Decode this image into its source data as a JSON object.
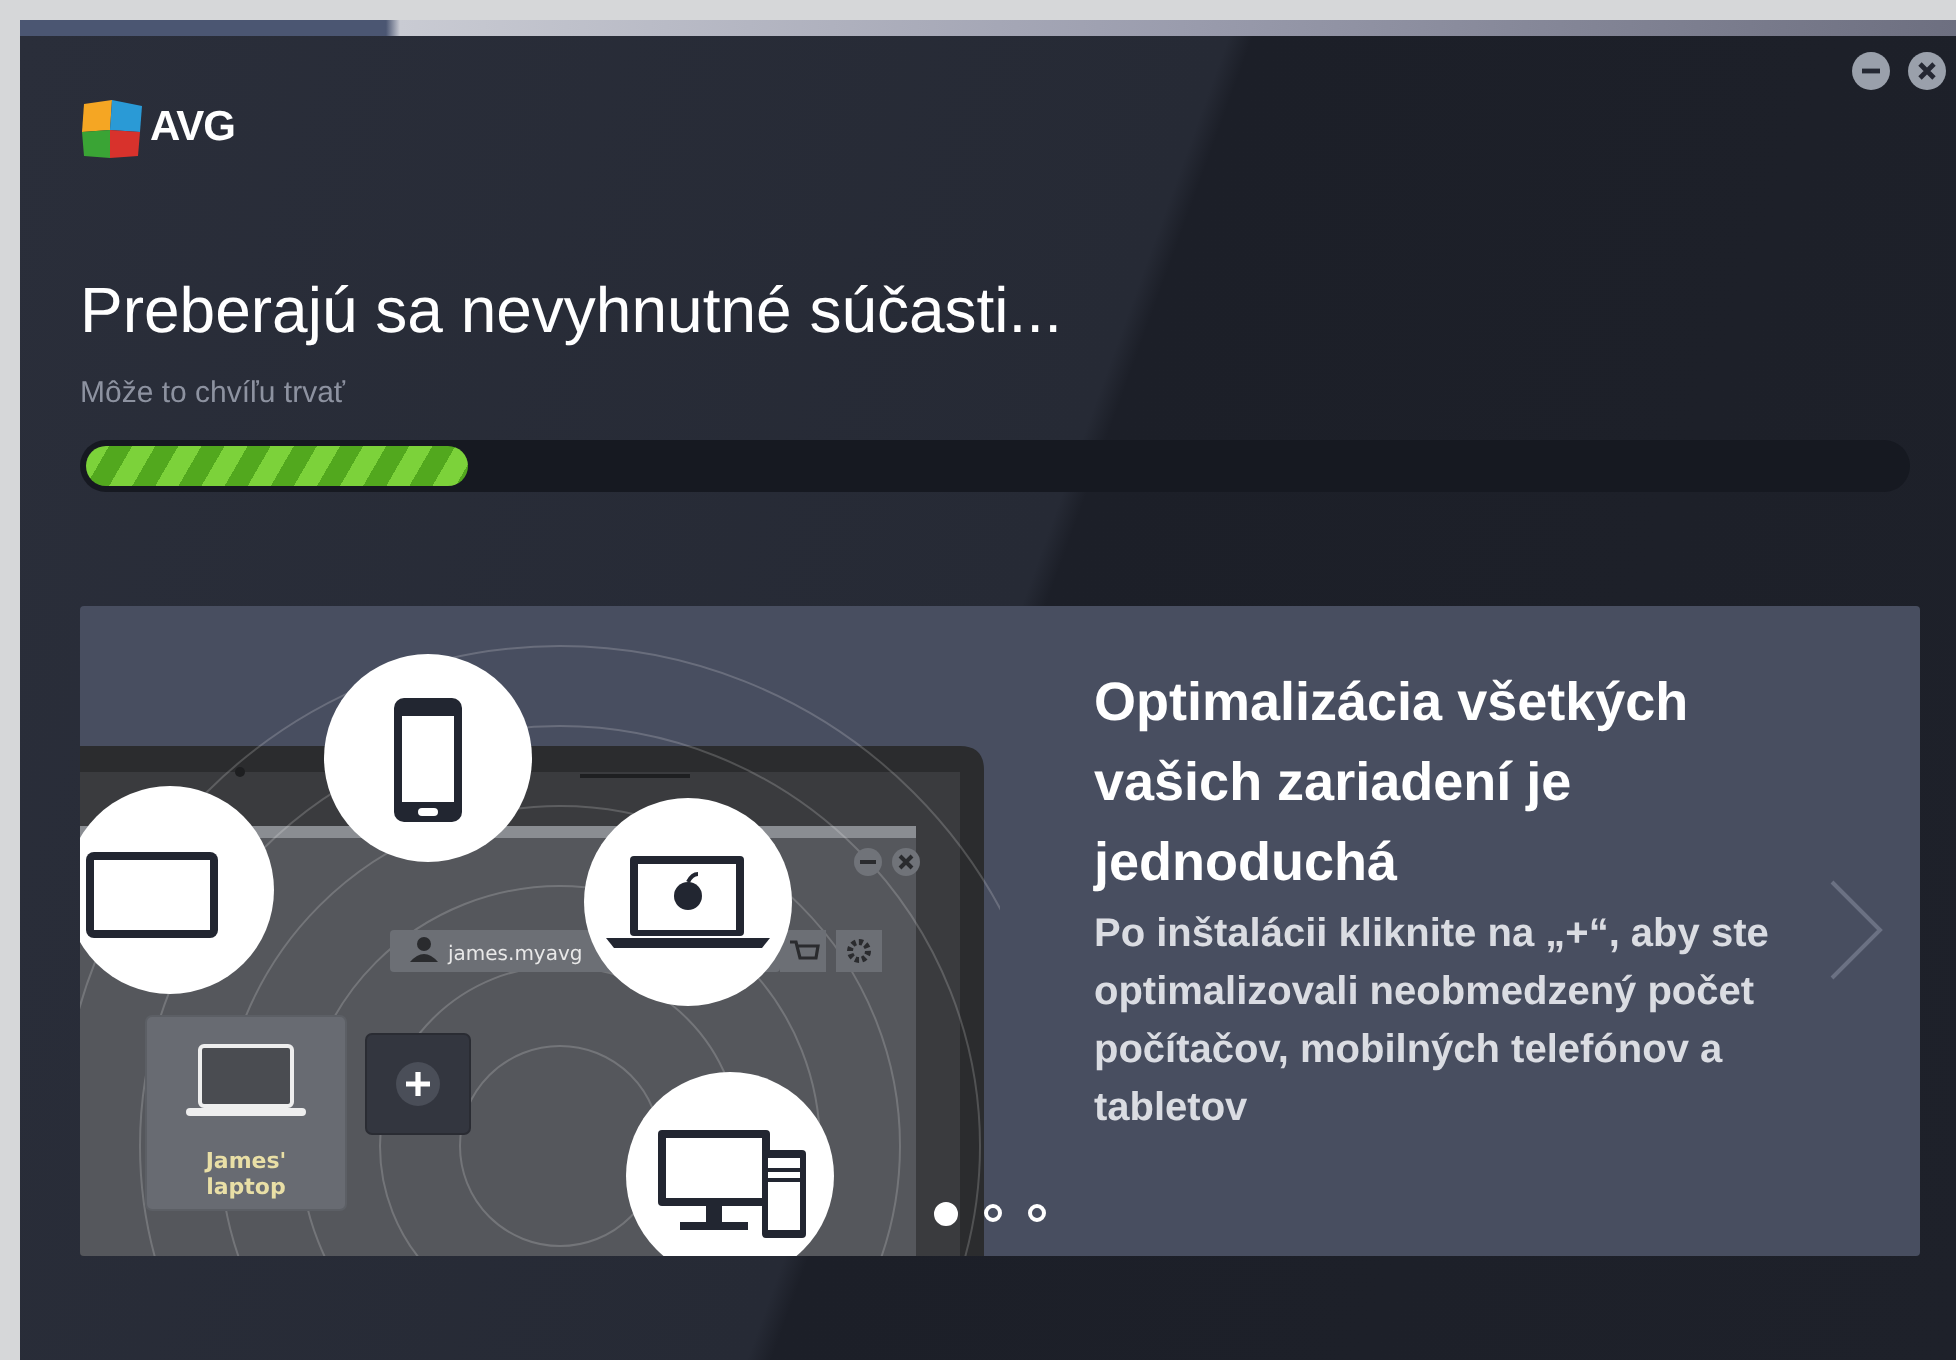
{
  "window": {
    "controls": [
      {
        "kind": "minimize"
      },
      {
        "kind": "close"
      }
    ]
  },
  "logo": {
    "text": "AVG"
  },
  "status": {
    "title": "Preberajú sa nevyhnutné súčasti...",
    "subtitle": "Môže to chvíľu trvať",
    "progress": {
      "level": 0.21
    }
  },
  "slide": {
    "illustration": {
      "account": "james.myavg",
      "device_label": "James' laptop"
    },
    "heading": "Optimalizácia všetkých vašich zariadení je jednoduchá",
    "body": "Po inštalácii kliknite na „+“, aby ste optimalizovali neobmedzený počet počítačov, mobilných telefónov a tabletov"
  },
  "pager": [
    {
      "selected": true
    },
    {
      "selected": false
    },
    {
      "selected": false
    }
  ]
}
